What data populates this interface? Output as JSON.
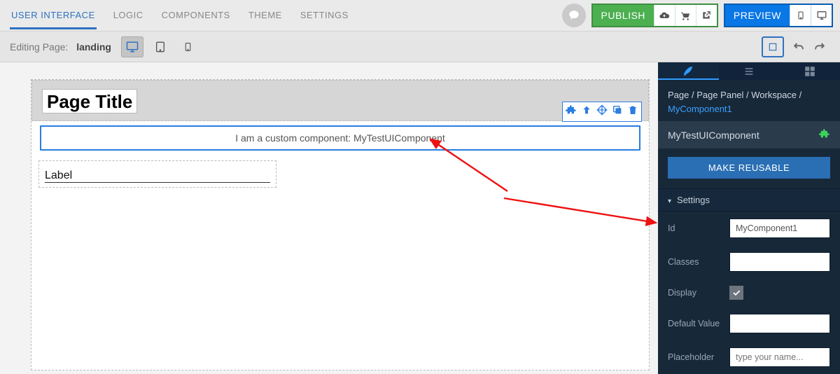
{
  "topnav": {
    "tabs": [
      "USER INTERFACE",
      "LOGIC",
      "COMPONENTS",
      "THEME",
      "SETTINGS"
    ],
    "active": 0,
    "publish": "PUBLISH",
    "preview": "PREVIEW"
  },
  "subbar": {
    "editing_prefix": "Editing Page:",
    "page_name": "landing"
  },
  "canvas": {
    "page_title": "Page Title",
    "custom_component_text": "I am a custom component: MyTestUIComponent",
    "label_text": "Label"
  },
  "inspector": {
    "breadcrumb": {
      "path": "Page / Page Panel / Workspace /",
      "leaf": "MyComponent1"
    },
    "component_name": "MyTestUIComponent",
    "make_reusable": "MAKE REUSABLE",
    "settings_header": "Settings",
    "fields": {
      "id_label": "Id",
      "id_value": "MyComponent1",
      "classes_label": "Classes",
      "classes_value": "",
      "display_label": "Display",
      "display_checked": true,
      "default_value_label": "Default Value",
      "default_value": "",
      "placeholder_label": "Placeholder",
      "placeholder_placeholder": "type your name..."
    }
  }
}
